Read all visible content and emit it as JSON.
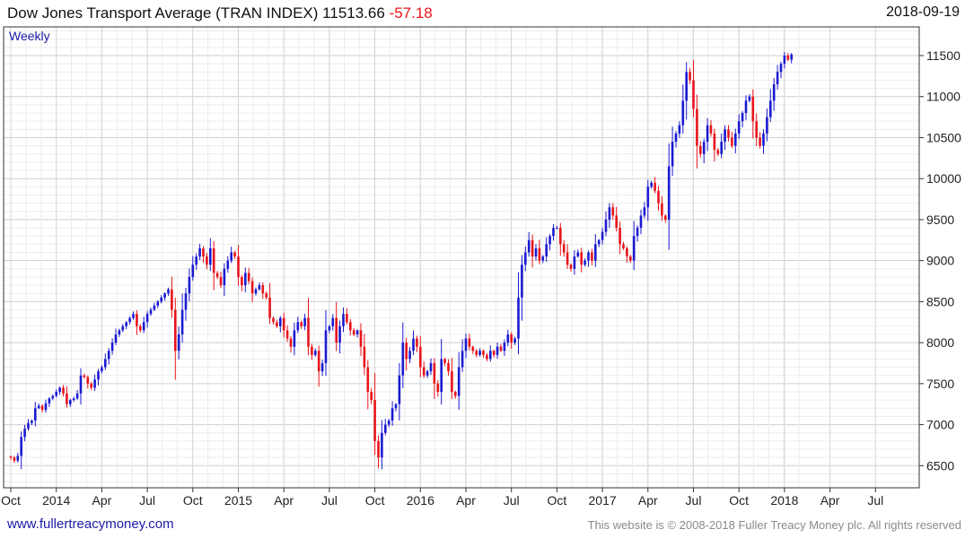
{
  "header": {
    "title": "Dow Jones Transport Average (TRAN INDEX)",
    "last": "11513.66",
    "change": "-57.18",
    "date": "2018-09-19"
  },
  "footer": {
    "link": "www.fullertreacymoney.com",
    "copyright": "This website is © 2008-2018 Fuller Treacy Money plc. All rights reserved"
  },
  "colors": {
    "up": "#1a1ad1",
    "down": "#e8141b",
    "grid": "#d9d9d9",
    "axis": "#333333"
  },
  "chart_data": {
    "type": "candlestick",
    "interval_label": "Weekly",
    "y_ticks": [
      6500,
      7000,
      7500,
      8000,
      8500,
      9000,
      9500,
      10000,
      10500,
      11000,
      11500
    ],
    "ylim": [
      6230,
      11850
    ],
    "x_ticks": [
      {
        "label": "Oct",
        "i": 0
      },
      {
        "label": "2014",
        "i": 13
      },
      {
        "label": "Apr",
        "i": 26
      },
      {
        "label": "Jul",
        "i": 39
      },
      {
        "label": "Oct",
        "i": 52
      },
      {
        "label": "2015",
        "i": 65
      },
      {
        "label": "Apr",
        "i": 78
      },
      {
        "label": "Jul",
        "i": 91
      },
      {
        "label": "Oct",
        "i": 104
      },
      {
        "label": "2016",
        "i": 117
      },
      {
        "label": "Apr",
        "i": 130
      },
      {
        "label": "Jul",
        "i": 143
      },
      {
        "label": "Oct",
        "i": 156
      },
      {
        "label": "2017",
        "i": 169
      },
      {
        "label": "Apr",
        "i": 182
      },
      {
        "label": "Jul",
        "i": 195
      },
      {
        "label": "Oct",
        "i": 208
      },
      {
        "label": "2018",
        "i": 221
      },
      {
        "label": "Apr",
        "i": 234
      },
      {
        "label": "Jul",
        "i": 247
      }
    ],
    "closes": [
      6600,
      6560,
      6620,
      6850,
      6950,
      7020,
      7050,
      7200,
      7230,
      7180,
      7260,
      7320,
      7350,
      7400,
      7450,
      7380,
      7250,
      7300,
      7320,
      7380,
      7600,
      7580,
      7500,
      7450,
      7550,
      7650,
      7700,
      7800,
      7900,
      8000,
      8100,
      8150,
      8200,
      8250,
      8300,
      8350,
      8200,
      8150,
      8250,
      8350,
      8400,
      8450,
      8500,
      8550,
      8600,
      8650,
      8400,
      7900,
      8100,
      8400,
      8600,
      8800,
      8950,
      9050,
      9150,
      9050,
      8950,
      9150,
      8850,
      8800,
      8700,
      8900,
      9000,
      9100,
      9050,
      8800,
      8700,
      8850,
      8750,
      8600,
      8650,
      8700,
      8600,
      8550,
      8300,
      8250,
      8200,
      8300,
      8150,
      8050,
      7950,
      8150,
      8250,
      8200,
      8300,
      7950,
      7850,
      7900,
      7650,
      7750,
      8150,
      8200,
      8300,
      8000,
      8200,
      8350,
      8250,
      8150,
      8100,
      8150,
      7950,
      7700,
      7400,
      7300,
      6800,
      6600,
      6900,
      7000,
      7050,
      7200,
      7250,
      7600,
      8000,
      7800,
      7900,
      8050,
      7950,
      7700,
      7600,
      7650,
      7750,
      7500,
      7400,
      7800,
      7750,
      7650,
      7400,
      7350,
      7700,
      7900,
      8050,
      7950,
      7900,
      7850,
      7900,
      7850,
      7800,
      7900,
      7850,
      7950,
      7900,
      8000,
      8100,
      8000,
      8050,
      8550,
      8950,
      9100,
      9250,
      9050,
      9150,
      9000,
      9050,
      9200,
      9300,
      9400,
      9400,
      9200,
      9100,
      8950,
      8900,
      9050,
      9100,
      8950,
      9000,
      9100,
      9000,
      9200,
      9250,
      9350,
      9500,
      9650,
      9550,
      9400,
      9200,
      9150,
      9050,
      9000,
      9300,
      9400,
      9550,
      9650,
      9900,
      9950,
      9850,
      9700,
      9550,
      9500,
      10150,
      10450,
      10550,
      10650,
      10950,
      11300,
      11200,
      10850,
      10400,
      10300,
      10450,
      10650,
      10550,
      10350,
      10300,
      10450,
      10600,
      10500,
      10400,
      10550,
      10700,
      10800,
      10950,
      11000,
      10700,
      10500,
      10400,
      10550,
      10750,
      10950,
      11150,
      11300,
      11400,
      11500,
      11450,
      11513.66
    ]
  }
}
